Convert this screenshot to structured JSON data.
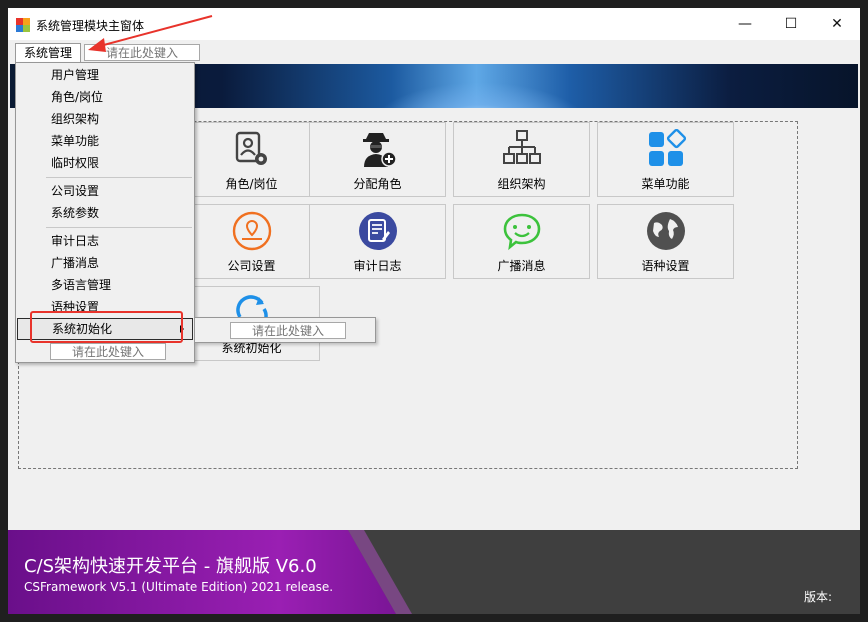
{
  "window": {
    "title": "系统管理模块主窗体",
    "controls": {
      "minimize": "—",
      "maximize": "☐",
      "close": "✕"
    }
  },
  "menubar": {
    "menu_label": "系统管理",
    "search_placeholder": "请在此处键入"
  },
  "dropdown": {
    "items": [
      {
        "label": "用户管理"
      },
      {
        "label": "角色/岗位"
      },
      {
        "label": "组织架构"
      },
      {
        "label": "菜单功能"
      },
      {
        "label": "临时权限"
      },
      {
        "label": "公司设置"
      },
      {
        "label": "系统参数"
      },
      {
        "label": "审计日志"
      },
      {
        "label": "广播消息"
      },
      {
        "label": "多语言管理"
      },
      {
        "label": "语种设置"
      },
      {
        "label": "系统初始化"
      }
    ],
    "bottom_placeholder": "请在此处键入",
    "submenu_placeholder": "请在此处键入"
  },
  "tiles": [
    {
      "label": "角色/岗位",
      "icon": "role-settings-icon"
    },
    {
      "label": "分配角色",
      "icon": "assign-role-icon"
    },
    {
      "label": "组织架构",
      "icon": "org-structure-icon"
    },
    {
      "label": "菜单功能",
      "icon": "menu-function-icon"
    },
    {
      "label": "公司设置",
      "icon": "company-location-icon"
    },
    {
      "label": "审计日志",
      "icon": "audit-log-icon"
    },
    {
      "label": "广播消息",
      "icon": "chat-bubble-icon"
    },
    {
      "label": "语种设置",
      "icon": "globe-icon"
    },
    {
      "label": "系统初始化",
      "icon": "refresh-icon"
    }
  ],
  "footer": {
    "title": "C/S架构快速开发平台 - 旗舰版 V6.0",
    "subtitle": "CSFramework V5.1 (Ultimate Edition) 2021 release.",
    "version_label": "版本:"
  },
  "colors": {
    "annotation_red": "#e8332b",
    "footer_purple": "#8a1aa0",
    "icon_blue": "#1e90e8",
    "icon_orange": "#f07020",
    "icon_green": "#3cc23c",
    "icon_navy": "#3b4aa0"
  }
}
